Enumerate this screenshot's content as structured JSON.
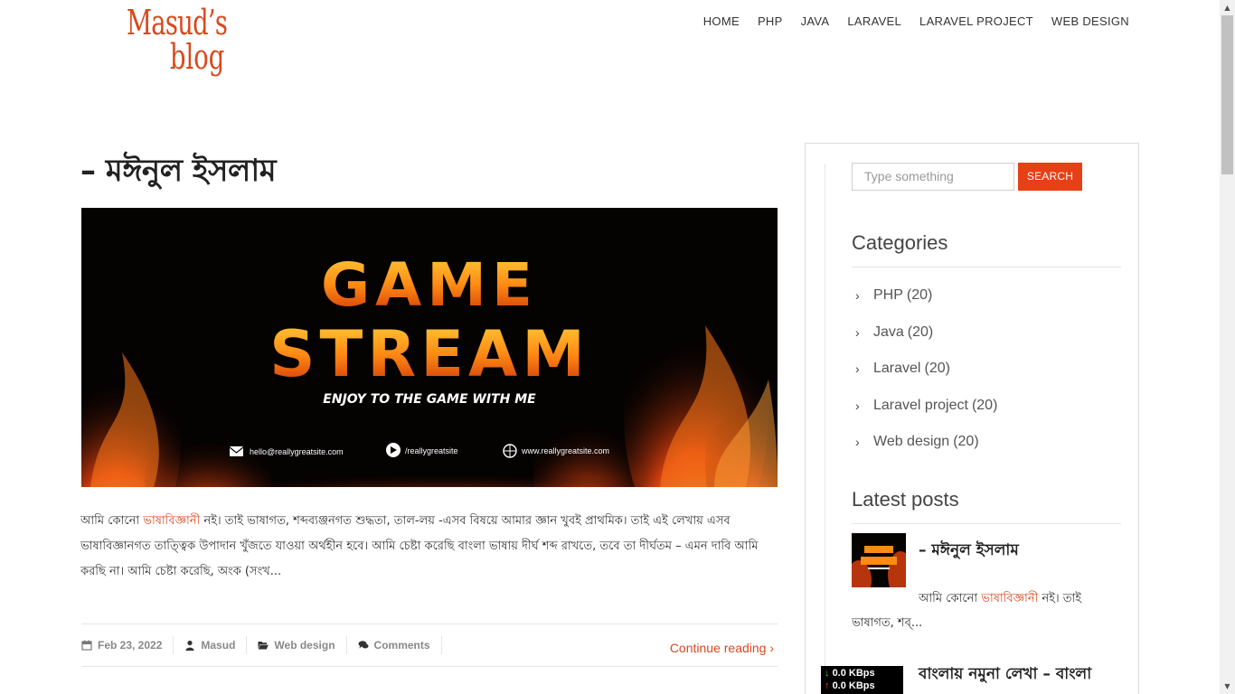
{
  "header": {
    "logo_line1": "Masud’s",
    "logo_line2": "blog",
    "nav": [
      "HOME",
      "PHP",
      "JAVA",
      "LARAVEL",
      "LARAVEL PROJECT",
      "WEB DESIGN"
    ]
  },
  "post": {
    "title": "– মঈনুল ইসলাম",
    "image": {
      "line1": "GAME",
      "line2": "STREAM",
      "tagline": "ENJOY TO THE GAME WITH ME",
      "email": "hello@reallygreatsite.com",
      "social": "/reallygreatsite",
      "website": "www.reallygreatsite.com"
    },
    "excerpt_pre": "আমি কোনো ",
    "excerpt_link": "ভাষাবিজ্ঞানী",
    "excerpt_post": " নই। তাই ভাষাগত, শব্দব্যঞ্জনগত শুদ্ধতা, তাল-লয় -এসব বিষয়ে আমার জ্ঞান খুবই প্রাথমিক। তাই এই লেখায় এসব ভাষাবিজ্ঞানগত তাত্ত্বিক উপাদান খুঁজতে যাওয়া অর্থহীন হবে। আমি চেষ্টা করেছি বাংলা ভাষায় দীর্ঘ শব্দ রাখতে, তবে তা দীর্ঘতম – এমন দাবি আমি করছি না। আমি চেষ্টা করেছি, অংক (সংখ...",
    "meta": {
      "date": "Feb 23, 2022",
      "author": "Masud",
      "category": "Web design",
      "comments": "Comments"
    },
    "continue": "Continue reading ›"
  },
  "sidebar": {
    "search_placeholder": "Type something",
    "search_button": "SEARCH",
    "categories_title": "Categories",
    "categories": [
      {
        "name": "PHP",
        "count": "(20)"
      },
      {
        "name": "Java",
        "count": "(20)"
      },
      {
        "name": "Laravel",
        "count": "(20)"
      },
      {
        "name": "Laravel project",
        "count": "(20)"
      },
      {
        "name": "Web design",
        "count": "(20)"
      }
    ],
    "latest_title": "Latest posts",
    "latest": [
      {
        "title": "– মঈনুল ইসলাম",
        "excerpt_pre": "আমি কোনো ",
        "excerpt_link": "ভাষাবিজ্ঞানী",
        "excerpt_post": " নই। তাই ভাষাগত, শব্..."
      },
      {
        "title": "বাংলায় নমুনা লেখা – বাংলা"
      }
    ]
  },
  "net_meter": {
    "down": "0.0 KBps",
    "up": "0.0 KBps"
  },
  "colors": {
    "accent": "#d9481d",
    "button": "#e64016"
  }
}
